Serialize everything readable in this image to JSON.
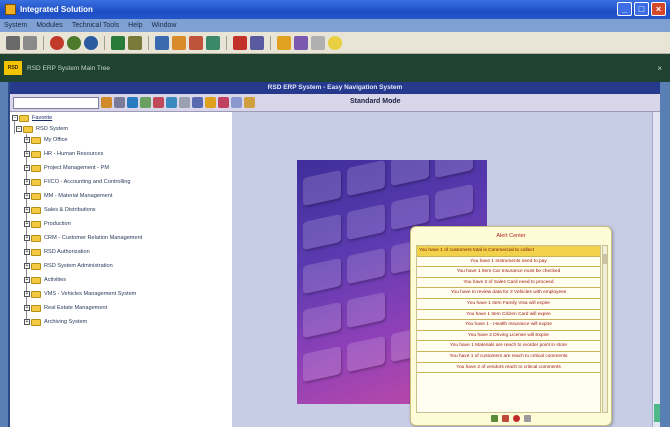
{
  "window": {
    "title": "Integrated Solution"
  },
  "menu": {
    "items": [
      "System",
      "Modules",
      "Technical Tools",
      "Help",
      "Window"
    ]
  },
  "tab": {
    "badge": "RSD",
    "label": "RSD ERP System Main Tree"
  },
  "banner": {
    "title": "RSD ERP System - Easy Navigation System"
  },
  "subbar": {
    "mode": "Standard Mode",
    "search_value": ""
  },
  "tree": {
    "favorite": "Favorite",
    "root": "RSD System",
    "items": [
      "My Office",
      "HR - Human Resources",
      "Project Management - PM",
      "FI/CO - Accounting and Controlling",
      "MM - Material Management",
      "Sales & Distributions",
      "Production",
      "CRM - Customer Relation Management",
      "RSD Authorization",
      "RSD System Administration",
      "Activities",
      "VMS - Vehicles Management System",
      "Real Estate Management",
      "Archiving System"
    ]
  },
  "alert": {
    "title": "Alert Center",
    "items": [
      "You have 1 of customers total is Commercial to collect",
      "You have 1 Instruments need to pay",
      "You have 1 Item Car Insurance must be checked",
      "You have 2 of Sales Card need to proceed",
      "You have to review data for 3 Vehicles with employees",
      "You have 1 Item Family Visa will expire",
      "You have 1 Item Citizen Card will expire",
      "You have 1 - Health Insurance will expire",
      "You have 2 Driving License will Expire",
      "You have 1 Materials are reach to reorder point in store",
      "You have 1 of customers are reach to critical comments",
      "You have 2 of vendors reach to critical comments"
    ]
  },
  "colors": {
    "titlebar": "#1d4fc4",
    "tabbar": "#1f4330",
    "banner": "#253a8c",
    "alert_text": "#a01818",
    "alert_selected": "#f2d24a"
  }
}
